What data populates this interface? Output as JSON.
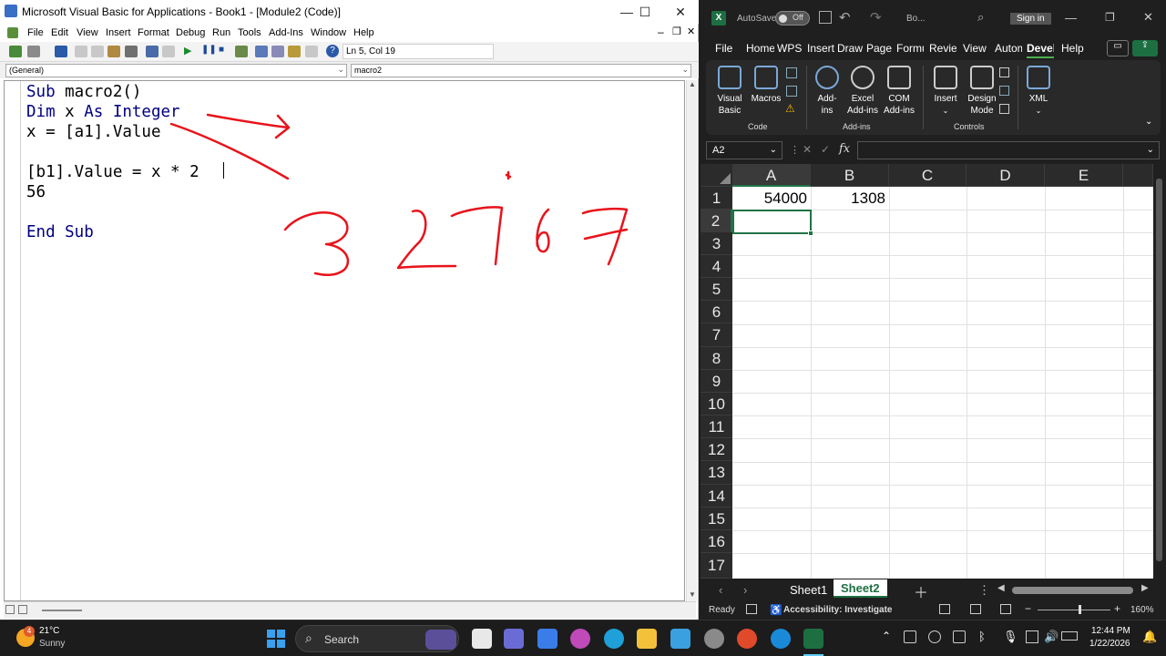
{
  "vbe": {
    "title": "Microsoft Visual Basic for Applications - Book1 - [Module2 (Code)]",
    "window_controls": {
      "minimize": "—",
      "maximize": "☐",
      "close": "✕"
    },
    "menu": [
      "File",
      "Edit",
      "View",
      "Insert",
      "Format",
      "Debug",
      "Run",
      "Tools",
      "Add-Ins",
      "Window",
      "Help"
    ],
    "position_readout": "Ln 5, Col 19",
    "object_combo": "(General)",
    "procedure_combo": "macro2",
    "code": {
      "line1_kw": "Sub",
      "line1_rest": " macro2()",
      "line2_kw": "Dim",
      "line2_mid": " x ",
      "line2_kw2": "As Integer",
      "line3": "x = [a1].Value",
      "line4": "",
      "line5": "[b1].Value = x * 2",
      "line6": "56",
      "line7": "",
      "line8": "End Sub"
    },
    "handwriting": "3 2767"
  },
  "excel": {
    "autosave_label": "AutoSave",
    "autosave_state": "Off",
    "doc_name": "Bo...",
    "signin": "Sign in",
    "tabs": [
      "File",
      "Home",
      "WPS",
      "Insert",
      "Draw",
      "Page",
      "Formu",
      "Review",
      "View",
      "Autom",
      "Devel",
      "Help"
    ],
    "active_tab": "Devel",
    "ribbon": {
      "visual_basic": "Visual Basic",
      "macros": "Macros",
      "group_code": "Code",
      "add_ins": "Add-ins",
      "excel_add_ins": "Excel Add-ins",
      "com_add_ins": "COM Add-ins",
      "group_addins": "Add-ins",
      "insert": "Insert",
      "design_mode": "Design Mode",
      "group_controls": "Controls",
      "xml": "XML"
    },
    "namebox": "A2",
    "fx": "fx",
    "columns": [
      "A",
      "B",
      "C",
      "D",
      "E"
    ],
    "rows": [
      "1",
      "2",
      "3",
      "4",
      "5",
      "6",
      "7",
      "8",
      "9",
      "10",
      "11",
      "12",
      "13",
      "14",
      "15",
      "16",
      "17"
    ],
    "cells": {
      "A1": "54000",
      "B1": "1308"
    },
    "sheets": [
      "Sheet1",
      "Sheet2"
    ],
    "active_sheet": "Sheet2",
    "status": {
      "ready": "Ready",
      "accessibility": "Accessibility: Investigate",
      "zoom": "160%"
    },
    "accent": "#217346"
  },
  "taskbar": {
    "weather_temp": "21°C",
    "weather_desc": "Sunny",
    "weather_badge": "4",
    "search": "Search",
    "time": "12:44 PM",
    "date": "1/22/2026"
  }
}
